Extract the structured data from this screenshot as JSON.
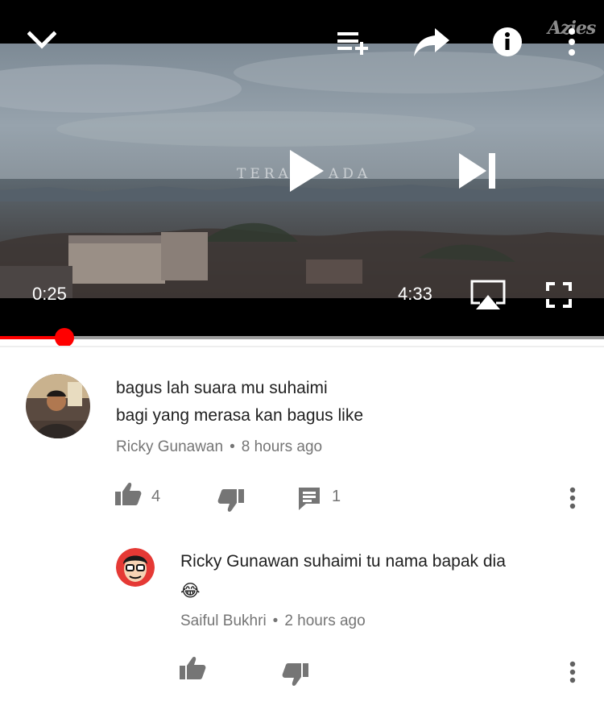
{
  "player": {
    "watermark": "Azies",
    "overlay_title_left": "TERA",
    "overlay_title_right": "ADA",
    "current_time": "0:25",
    "duration": "4:33",
    "progress": 0.106,
    "icons": [
      "chevron-down-icon",
      "add-to-playlist-icon",
      "share-icon",
      "info-icon",
      "more-vert-icon",
      "play-icon",
      "skip-next-icon",
      "airplay-icon",
      "fullscreen-icon"
    ]
  },
  "comment": {
    "line1": "bagus lah suara mu suhaimi",
    "line2": "bagi yang merasa kan bagus like",
    "author": "Ricky Gunawan",
    "separator": "•",
    "time": "8 hours ago",
    "like_count": "4",
    "reply_count": "1"
  },
  "reply": {
    "line1": "Ricky Gunawan suhaimi tu nama bapak dia",
    "emoji": "😂",
    "author": "Saiful Bukhri",
    "separator": "•",
    "time": "2 hours ago"
  }
}
